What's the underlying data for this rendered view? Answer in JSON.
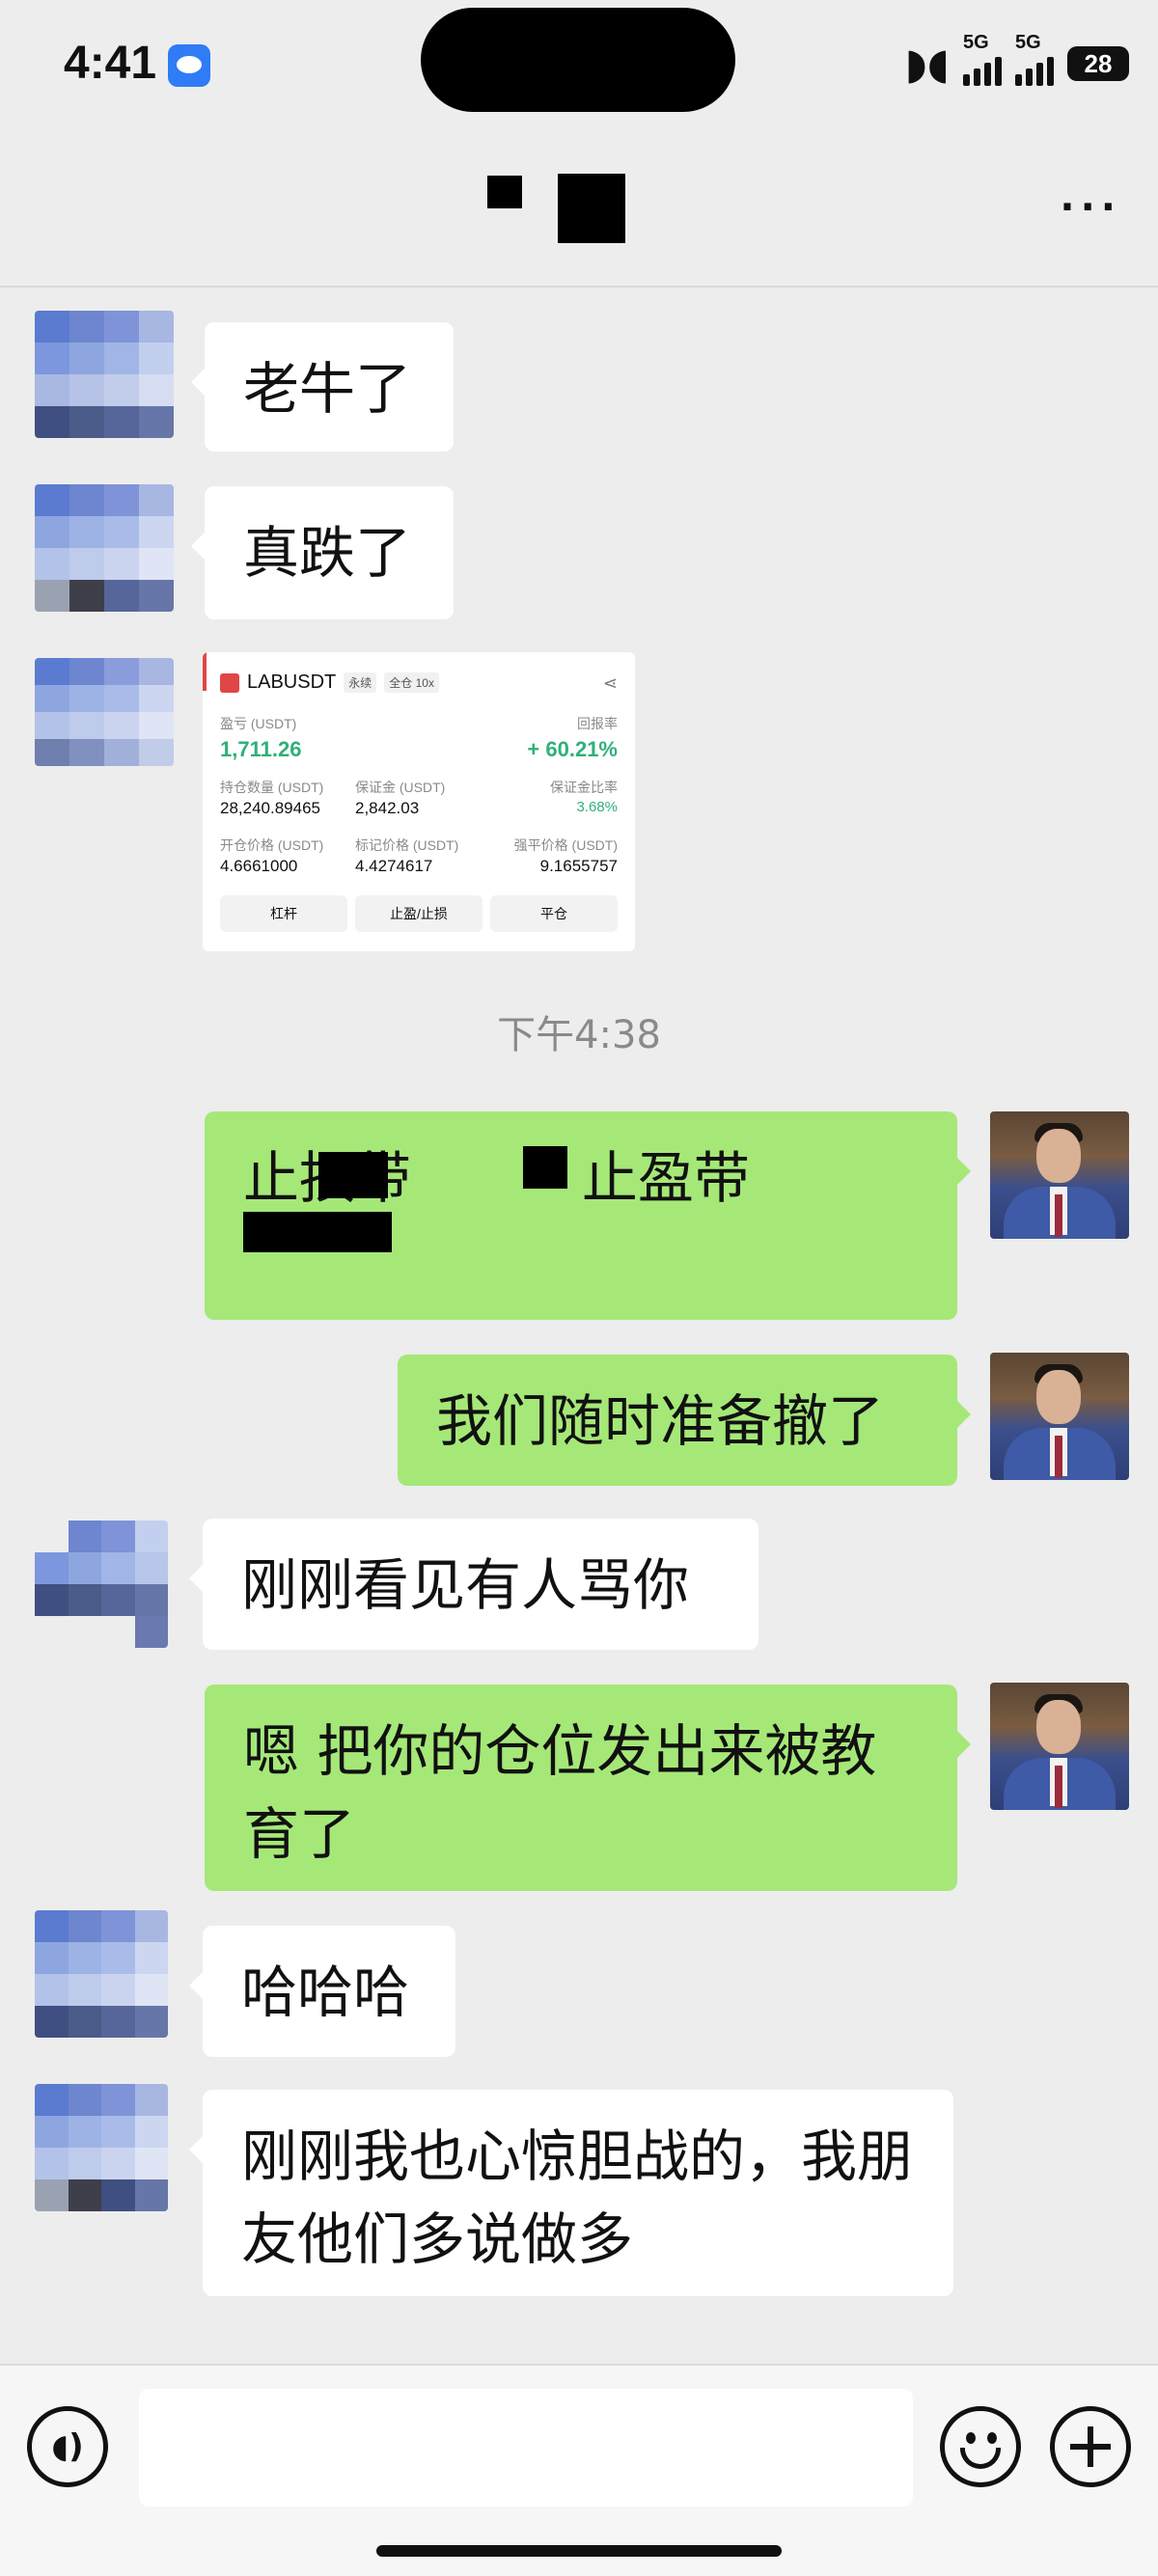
{
  "status_bar": {
    "time": "4:41",
    "network_1": "5G",
    "network_2": "5G",
    "battery": "28"
  },
  "header": {
    "more": "···"
  },
  "messages": [
    {
      "side": "in",
      "text": "老牛了"
    },
    {
      "side": "in",
      "text": "真跌了"
    },
    {
      "side": "in",
      "type": "image"
    },
    {
      "side": "out",
      "text_a": "止损带",
      "text_b": "止盈带"
    },
    {
      "side": "out",
      "text": "我们随时准备撤了"
    },
    {
      "side": "in",
      "text": "刚刚看见有人骂你"
    },
    {
      "side": "out",
      "text": "嗯 把你的仓位发出来被教育了"
    },
    {
      "side": "in",
      "text": "哈哈哈"
    },
    {
      "side": "in",
      "text": "刚刚我也心惊胆战的，我朋友他们多说做多"
    }
  ],
  "timestamp": "下午4:38",
  "trade_card": {
    "symbol": "LABUSDT",
    "tag_type": "永续",
    "tag_margin": "全仓 10x",
    "pnl_label": "盈亏 (USDT)",
    "pnl_value": "1,711.26",
    "roe_label": "回报率",
    "roe_value": "+ 60.21%",
    "size_label": "持仓数量 (USDT)",
    "size_value": "28,240.89465",
    "margin_label": "保证金 (USDT)",
    "margin_value": "2,842.03",
    "margin_ratio_label": "保证金比率",
    "margin_ratio_value": "3.68%",
    "entry_label": "开仓价格 (USDT)",
    "entry_value": "4.6661000",
    "mark_label": "标记价格 (USDT)",
    "mark_value": "4.4274617",
    "liq_label": "强平价格 (USDT)",
    "liq_value": "9.1655757",
    "btn_leverage": "杠杆",
    "btn_tpsl": "止盈/止损",
    "btn_close": "平仓"
  },
  "colors": {
    "outgoing_bubble": "#a5e878",
    "incoming_bubble": "#ffffff",
    "background": "#ededed",
    "profit_green": "#2fb07a"
  },
  "icons": {
    "voice": "voice-icon",
    "emoji": "emoji-icon",
    "plus": "plus-icon",
    "more": "more-icon"
  }
}
